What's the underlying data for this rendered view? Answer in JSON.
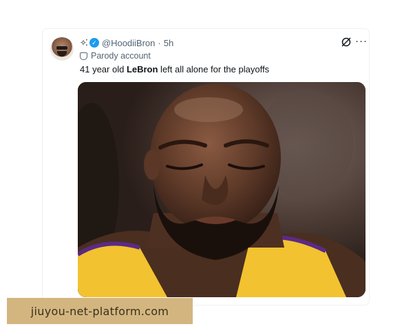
{
  "tweet": {
    "display_name_prefix": "✧⁚",
    "handle": "@HoodiiBron",
    "separator": "·",
    "time": "5h",
    "label": "Parody account",
    "text_before": "41 year old ",
    "text_bold": "LeBron",
    "text_after": " left all alone for the playoffs",
    "verified_color": "#1d9bf0",
    "more_label": "···"
  },
  "icons": {
    "verified": "verified-icon",
    "parody": "mask-icon",
    "grok": "grok-icon",
    "more": "more-icon"
  },
  "watermark": {
    "text": "jiuyou-net-platform.com",
    "color": "#d3b67f"
  }
}
